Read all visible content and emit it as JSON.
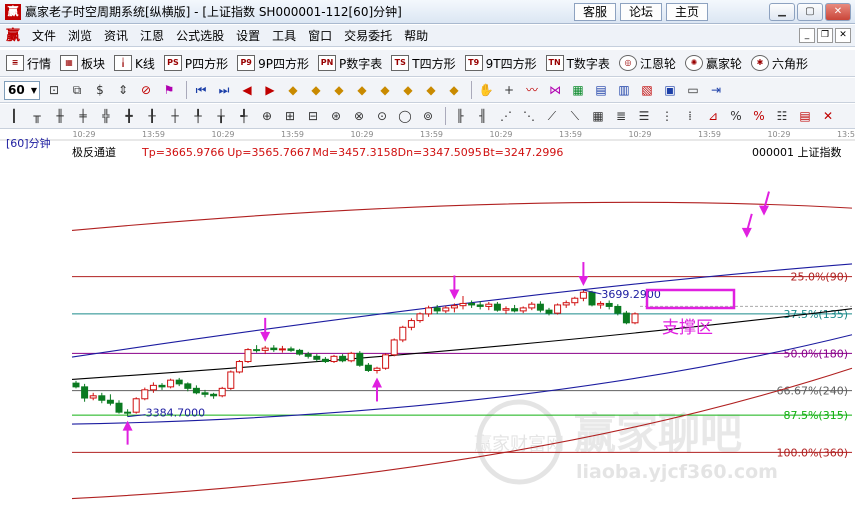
{
  "window": {
    "title": "赢家老子时空周期系统[纵横版] - [上证指数   SH000001-112[60]分钟]",
    "links": [
      "客服",
      "论坛",
      "主页"
    ]
  },
  "menu": {
    "items": [
      "文件",
      "浏览",
      "资讯",
      "江恩",
      "公式选股",
      "设置",
      "工具",
      "窗口",
      "交易委托",
      "帮助"
    ]
  },
  "toolbar1": {
    "items": [
      {
        "icon": "list-icon",
        "label": "行情"
      },
      {
        "icon": "grid-icon",
        "label": "板块"
      },
      {
        "icon": "candle-icon",
        "label": "K线"
      },
      {
        "icon": "p-square-icon",
        "label": "P四方形"
      },
      {
        "icon": "9p-square-icon",
        "label": "9P四方形"
      },
      {
        "icon": "pn-table-icon",
        "label": "P数字表"
      },
      {
        "icon": "t-square-icon",
        "label": "T四方形"
      },
      {
        "icon": "9t-square-icon",
        "label": "9T四方形"
      },
      {
        "icon": "tn-table-icon",
        "label": "T数字表"
      },
      {
        "icon": "gann-wheel-icon",
        "label": "江恩轮"
      },
      {
        "icon": "winner-wheel-icon",
        "label": "赢家轮"
      },
      {
        "icon": "hexagon-icon",
        "label": "六角形"
      }
    ]
  },
  "toolbar2": {
    "period": "60"
  },
  "chart": {
    "period_label": "[60]分钟",
    "indicator": "极反通道",
    "params": [
      {
        "key": "Tp",
        "value": "3665.9766"
      },
      {
        "key": "Up",
        "value": "3565.7667"
      },
      {
        "key": "Md",
        "value": "3457.3158"
      },
      {
        "key": "Dn",
        "value": "3347.5095"
      },
      {
        "key": "Bt",
        "value": "3247.2996"
      }
    ],
    "symbol": "000001 上证指数",
    "time_ticks": [
      "10:29",
      "13:59",
      "10:29",
      "13:59",
      "10:29",
      "13:59",
      "10:29",
      "13:59",
      "10:29",
      "13:59",
      "10:29",
      "13:59"
    ],
    "price_marks": [
      {
        "text": "3699.2900"
      },
      {
        "text": "3384.7000"
      }
    ],
    "levels": [
      {
        "label": "25.0%(90)",
        "color": "#b02020"
      },
      {
        "label": "37.5%(135)",
        "color": "#1a8a8a"
      },
      {
        "label": "50.0%(180)",
        "color": "#8a008a"
      },
      {
        "label": "66.67%(240)",
        "color": "#606060"
      },
      {
        "label": "87.5%(315)",
        "color": "#10b010"
      },
      {
        "label": "100.0%(360)",
        "color": "#b02020"
      }
    ],
    "support_label": "支撑区",
    "watermark": {
      "title": "赢家聊吧",
      "url": "liaoba.yjcf360.com",
      "badge": "赢家财富网"
    },
    "colors": {
      "up": "#d01010",
      "down": "#0a7a20",
      "arrow": "#e020e0",
      "channel": "#1c1ca0",
      "mid": "#000000"
    }
  },
  "chart_data": {
    "type": "candlestick",
    "title": "极反通道",
    "candles": [
      [
        3405,
        3408,
        3398,
        3400
      ],
      [
        3400,
        3404,
        3380,
        3385
      ],
      [
        3385,
        3392,
        3382,
        3388
      ],
      [
        3388,
        3392,
        3378,
        3382
      ],
      [
        3382,
        3390,
        3375,
        3378
      ],
      [
        3378,
        3382,
        3364,
        3366
      ],
      [
        3366,
        3370,
        3360,
        3365
      ],
      [
        3366,
        3386,
        3364,
        3384
      ],
      [
        3384,
        3399,
        3382,
        3396
      ],
      [
        3396,
        3406,
        3392,
        3402
      ],
      [
        3402,
        3405,
        3396,
        3400
      ],
      [
        3400,
        3411,
        3398,
        3409
      ],
      [
        3409,
        3412,
        3401,
        3404
      ],
      [
        3404,
        3406,
        3394,
        3398
      ],
      [
        3398,
        3402,
        3390,
        3392
      ],
      [
        3392,
        3396,
        3386,
        3390
      ],
      [
        3390,
        3392,
        3384,
        3388
      ],
      [
        3388,
        3400,
        3386,
        3398
      ],
      [
        3398,
        3422,
        3396,
        3420
      ],
      [
        3420,
        3436,
        3418,
        3434
      ],
      [
        3434,
        3452,
        3432,
        3450
      ],
      [
        3450,
        3456,
        3446,
        3449
      ],
      [
        3449,
        3455,
        3444,
        3452
      ],
      [
        3452,
        3456,
        3447,
        3450
      ],
      [
        3450,
        3455,
        3446,
        3451
      ],
      [
        3451,
        3454,
        3447,
        3449
      ],
      [
        3449,
        3451,
        3442,
        3444
      ],
      [
        3444,
        3447,
        3438,
        3441
      ],
      [
        3441,
        3444,
        3434,
        3437
      ],
      [
        3437,
        3440,
        3432,
        3434
      ],
      [
        3434,
        3443,
        3432,
        3441
      ],
      [
        3441,
        3444,
        3433,
        3435
      ],
      [
        3435,
        3447,
        3433,
        3445
      ],
      [
        3445,
        3448,
        3427,
        3429
      ],
      [
        3429,
        3432,
        3420,
        3422
      ],
      [
        3422,
        3427,
        3418,
        3425
      ],
      [
        3425,
        3445,
        3423,
        3443
      ],
      [
        3443,
        3465,
        3441,
        3463
      ],
      [
        3463,
        3482,
        3460,
        3480
      ],
      [
        3480,
        3492,
        3476,
        3489
      ],
      [
        3489,
        3500,
        3486,
        3498
      ],
      [
        3498,
        3509,
        3494,
        3506
      ],
      [
        3506,
        3510,
        3498,
        3502
      ],
      [
        3502,
        3509,
        3499,
        3506
      ],
      [
        3506,
        3512,
        3500,
        3509
      ],
      [
        3509,
        3522,
        3504,
        3512
      ],
      [
        3512,
        3516,
        3506,
        3510
      ],
      [
        3510,
        3515,
        3504,
        3508
      ],
      [
        3508,
        3514,
        3503,
        3511
      ],
      [
        3511,
        3514,
        3501,
        3503
      ],
      [
        3503,
        3508,
        3498,
        3505
      ],
      [
        3505,
        3510,
        3500,
        3502
      ],
      [
        3502,
        3508,
        3499,
        3506
      ],
      [
        3506,
        3514,
        3503,
        3511
      ],
      [
        3511,
        3515,
        3500,
        3503
      ],
      [
        3503,
        3506,
        3496,
        3499
      ],
      [
        3499,
        3512,
        3497,
        3510
      ],
      [
        3510,
        3516,
        3506,
        3513
      ],
      [
        3513,
        3521,
        3509,
        3519
      ],
      [
        3519,
        3530,
        3515,
        3527
      ],
      [
        3527,
        3529,
        3508,
        3510
      ],
      [
        3510,
        3515,
        3505,
        3512
      ],
      [
        3512,
        3516,
        3504,
        3508
      ],
      [
        3508,
        3511,
        3496,
        3499
      ],
      [
        3499,
        3502,
        3484,
        3486
      ],
      [
        3486,
        3500,
        3484,
        3498
      ]
    ],
    "channels": [
      {
        "name": "Tp",
        "start": 3610,
        "mid": 3665,
        "end": 3640
      },
      {
        "name": "Up",
        "start": 3440,
        "mid": 3530,
        "end": 3565
      },
      {
        "name": "Md",
        "start": 3410,
        "mid": 3450,
        "end": 3505
      },
      {
        "name": "Dn",
        "start": 3350,
        "mid": 3360,
        "end": 3470
      },
      {
        "name": "Bt",
        "start": 3250,
        "mid": 3280,
        "end": 3425
      }
    ],
    "levels": [
      {
        "label": "25.0%(90)",
        "price": 3548
      },
      {
        "label": "37.5%(135)",
        "price": 3498
      },
      {
        "label": "50.0%(180)",
        "price": 3445
      },
      {
        "label": "66.67%(240)",
        "price": 3395
      },
      {
        "label": "87.5%(315)",
        "price": 3362
      },
      {
        "label": "100.0%(360)",
        "price": 3312
      }
    ],
    "price_marks": [
      {
        "text": "3699.2900",
        "candle": 59
      },
      {
        "text": "3384.7000",
        "candle": 6
      }
    ],
    "arrows": [
      {
        "candle": 6,
        "dir": "up"
      },
      {
        "candle": 22,
        "dir": "down"
      },
      {
        "candle": 35,
        "dir": "up"
      },
      {
        "candle": 44,
        "dir": "down"
      },
      {
        "candle": 59,
        "dir": "down"
      },
      {
        "candle": 80,
        "dir": "down"
      },
      {
        "candle": 78,
        "dir": "down"
      }
    ]
  }
}
